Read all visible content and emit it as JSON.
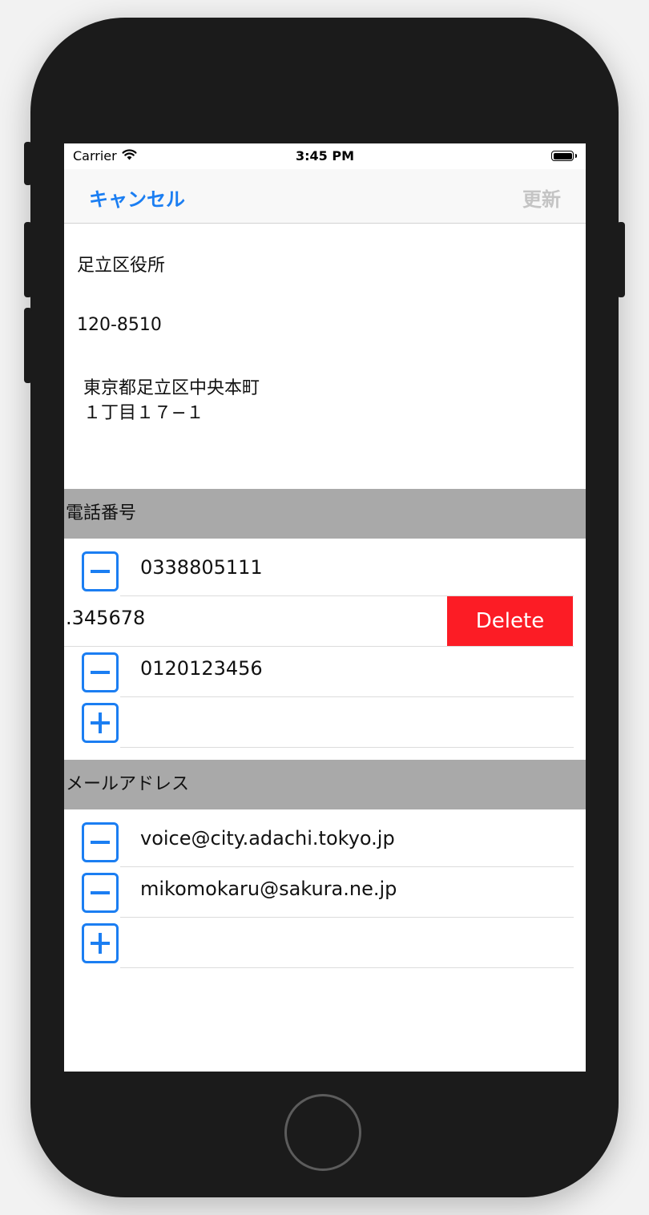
{
  "status_bar": {
    "carrier": "Carrier",
    "time": "3:45 PM"
  },
  "nav": {
    "cancel_label": "キャンセル",
    "update_label": "更新"
  },
  "facility": {
    "name": "足立区役所",
    "postal_code": "120-8510",
    "address_line1": "東京都足立区中央本町",
    "address_line2": "１丁目１７−１"
  },
  "phone_section": {
    "header": "電話番号",
    "rows": [
      {
        "value": "0338805111"
      },
      {
        "value": ".345678",
        "delete_label": "Delete"
      },
      {
        "value": "0120123456"
      }
    ]
  },
  "email_section": {
    "header": "メールアドレス",
    "rows": [
      {
        "value": "voice@city.adachi.tokyo.jp"
      },
      {
        "value": "mikomokaru@sakura.ne.jp"
      }
    ]
  },
  "colors": {
    "accent": "#1b7ef2",
    "delete": "#fc1c25",
    "section_header": "#a9a9a9"
  }
}
